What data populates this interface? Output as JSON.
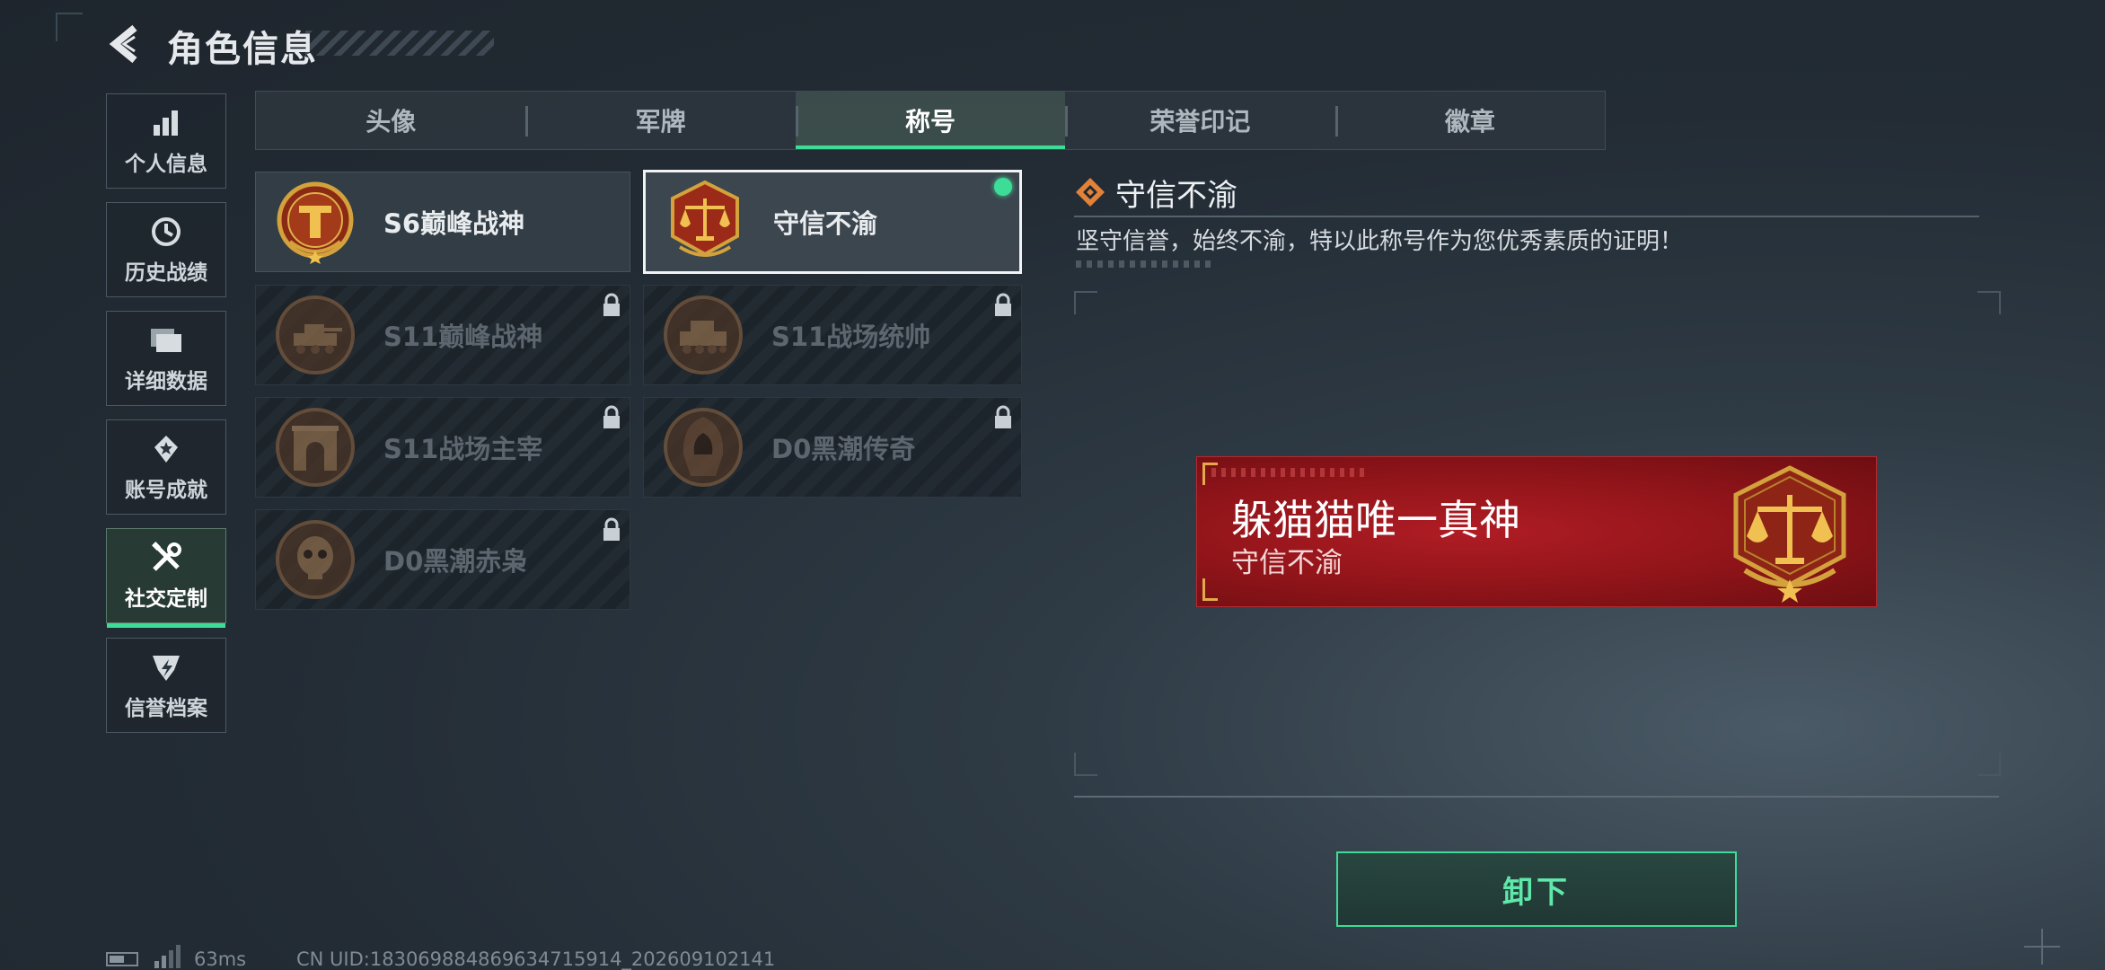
{
  "header": {
    "title": "角色信息"
  },
  "nav": [
    {
      "label": "个人信息",
      "icon": "bar-chart-icon"
    },
    {
      "label": "历史战绩",
      "icon": "history-clock-icon"
    },
    {
      "label": "详细数据",
      "icon": "folder-icon"
    },
    {
      "label": "账号成就",
      "icon": "achievement-icon"
    },
    {
      "label": "社交定制",
      "icon": "tools-icon",
      "active": true
    },
    {
      "label": "信誉档案",
      "icon": "shield-icon"
    }
  ],
  "tabs": [
    {
      "label": "头像"
    },
    {
      "label": "军牌"
    },
    {
      "label": "称号",
      "active": true
    },
    {
      "label": "荣誉印记"
    },
    {
      "label": "徽章"
    }
  ],
  "titles": [
    {
      "name": "S6巅峰战神",
      "locked": false
    },
    {
      "name": "守信不渝",
      "locked": false,
      "selected": true,
      "equipped": true
    },
    {
      "name": "S11巅峰战神",
      "locked": true
    },
    {
      "name": "S11战场统帅",
      "locked": true
    },
    {
      "name": "S11战场主宰",
      "locked": true
    },
    {
      "name": "D0黑潮传奇",
      "locked": true
    },
    {
      "name": "D0黑潮赤枭",
      "locked": true
    }
  ],
  "detail": {
    "title": "守信不渝",
    "description": "坚守信誉，始终不渝，特以此称号作为您优秀素质的证明！"
  },
  "nameplate": {
    "player_name": "躲猫猫唯一真神",
    "title": "守信不渝",
    "color": "#9b161c"
  },
  "actions": {
    "unequip_label": "卸下"
  },
  "status": {
    "ping": "63ms",
    "uid": "CN UID:183069884869634715914_202609102141"
  },
  "colors": {
    "accent": "#3ddc97",
    "gold": "#d4a23c",
    "bronze": "#8a5a32"
  }
}
